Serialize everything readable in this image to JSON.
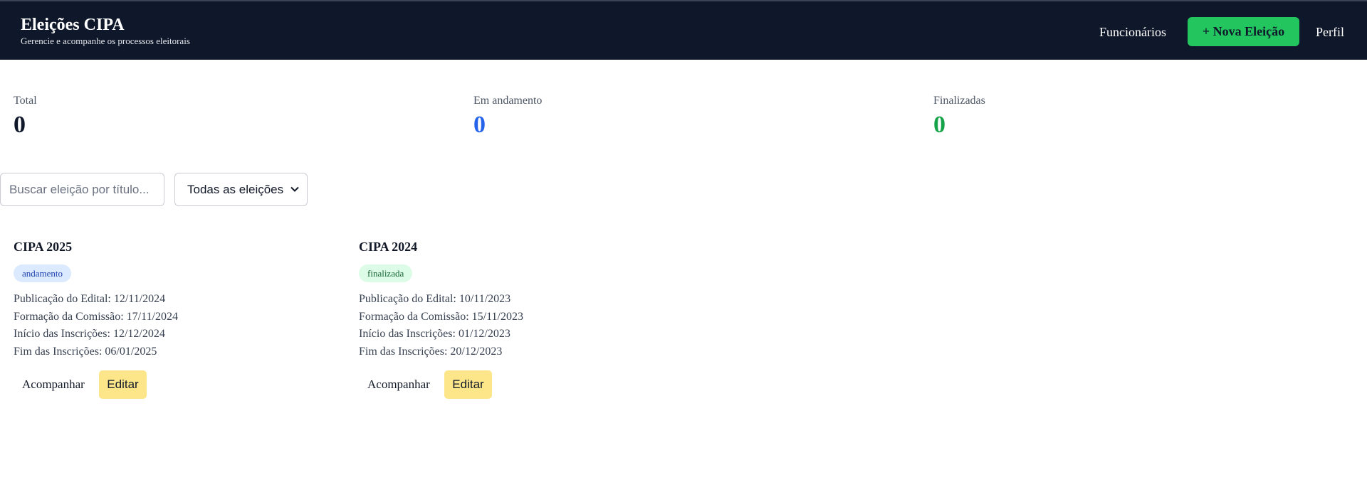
{
  "header": {
    "title": "Eleições CIPA",
    "subtitle": "Gerencie e acompanhe os processos eleitorais",
    "nav_employees": "Funcionários",
    "new_election": "+ Nova Eleição",
    "nav_profile": "Perfil"
  },
  "stats": [
    {
      "label": "Total",
      "value": "0",
      "color": "#0f172a"
    },
    {
      "label": "Em andamento",
      "value": "0",
      "color": "#2563eb"
    },
    {
      "label": "Finalizadas",
      "value": "0",
      "color": "#16a34a"
    }
  ],
  "filters": {
    "search_placeholder": "Buscar eleição por título...",
    "search_value": "",
    "select_value": "Todas as eleições"
  },
  "cards": [
    {
      "title": "CIPA 2025",
      "status": "andamento",
      "status_bg": "#dbeafe",
      "status_color": "#1e40af",
      "details": [
        "Publicação do Edital: 12/11/2024",
        "Formação da Comissão: 17/11/2024",
        "Início das Inscrições: 12/12/2024",
        "Fim das Inscrições: 06/01/2025"
      ],
      "follow_label": "Acompanhar",
      "edit_label": "Editar"
    },
    {
      "title": "CIPA 2024",
      "status": "finalizada",
      "status_bg": "#dcfce7",
      "status_color": "#166534",
      "details": [
        "Publicação do Edital: 10/11/2023",
        "Formação da Comissão: 15/11/2023",
        "Início das Inscrições: 01/12/2023",
        "Fim das Inscrições: 20/12/2023"
      ],
      "follow_label": "Acompanhar",
      "edit_label": "Editar"
    }
  ]
}
